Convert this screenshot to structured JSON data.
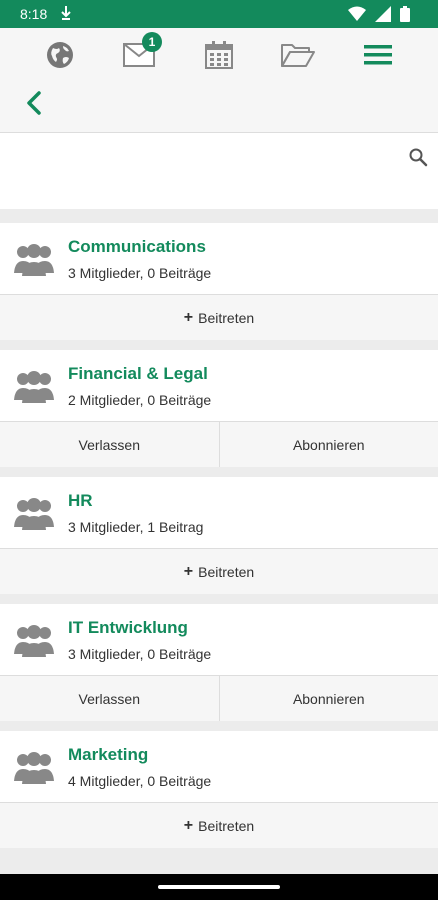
{
  "status_bar": {
    "time": "8:18"
  },
  "toolbar": {
    "messages_badge": "1",
    "icons": [
      "globe-icon",
      "mail-icon",
      "calendar-icon",
      "folder-icon",
      "menu-icon"
    ],
    "accent": "#138a5c"
  },
  "search": {
    "placeholder": ""
  },
  "groups": [
    {
      "title": "Communications",
      "meta": "3 Mitglieder, 0 Beiträge",
      "actions": [
        "Beitreten"
      ]
    },
    {
      "title": "Financial & Legal",
      "meta": "2 Mitglieder, 0 Beiträge",
      "actions": [
        "Verlassen",
        "Abonnieren"
      ]
    },
    {
      "title": "HR",
      "meta": "3 Mitglieder, 1 Beitrag",
      "actions": [
        "Beitreten"
      ]
    },
    {
      "title": "IT Entwicklung",
      "meta": "3 Mitglieder, 0 Beiträge",
      "actions": [
        "Verlassen",
        "Abonnieren"
      ]
    },
    {
      "title": "Marketing",
      "meta": "4 Mitglieder, 0 Beiträge",
      "actions": [
        "Beitreten"
      ]
    }
  ]
}
